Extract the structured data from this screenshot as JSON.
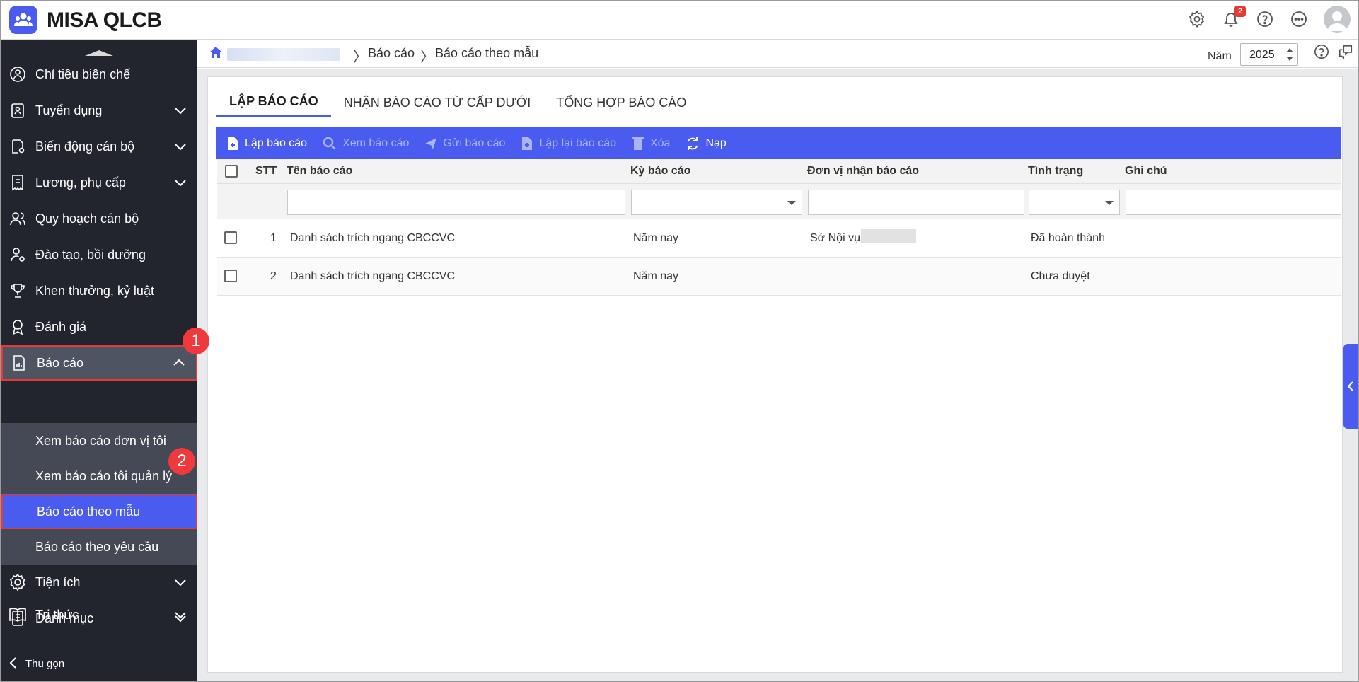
{
  "app": {
    "name": "MISA QLCB"
  },
  "topbar": {
    "notification_count": "2"
  },
  "sidebar": {
    "items": [
      {
        "label": "Chỉ tiêu biên chế"
      },
      {
        "label": "Tuyển dụng"
      },
      {
        "label": "Biến động cán bộ"
      },
      {
        "label": "Lương, phụ cấp"
      },
      {
        "label": "Quy hoạch cán bộ"
      },
      {
        "label": "Đào tạo, bồi dưỡng"
      },
      {
        "label": "Khen thưởng, kỷ luật"
      },
      {
        "label": "Đánh giá"
      },
      {
        "label": "Báo cáo"
      },
      {
        "label": "Tiện ích"
      },
      {
        "label": "Danh mục"
      },
      {
        "label": "Tri thức"
      }
    ],
    "sub_items": [
      {
        "label": "Xem báo cáo đơn vị tôi"
      },
      {
        "label": "Xem báo cáo tôi quản lý"
      },
      {
        "label": "Báo cáo theo mẫu"
      },
      {
        "label": "Báo cáo theo yêu cầu"
      }
    ],
    "step_markers": [
      "1",
      "2"
    ],
    "collapse_label": "Thu gọn"
  },
  "breadcrumb": {
    "items": [
      "Báo cáo",
      "Báo cáo theo mẫu"
    ],
    "year_label": "Năm",
    "year_value": "2025"
  },
  "tabs": [
    "LẬP BÁO CÁO",
    "NHẬN BÁO CÁO TỪ CẤP DƯỚI",
    "TỔNG HỢP BÁO CÁO"
  ],
  "toolbar": {
    "create": "Lập báo cáo",
    "view": "Xem báo cáo",
    "send": "Gửi báo cáo",
    "recreate": "Lập lại báo cáo",
    "delete": "Xóa",
    "reload": "Nạp"
  },
  "table": {
    "columns": [
      "STT",
      "Tên báo cáo",
      "Kỳ báo cáo",
      "Đơn vị nhận báo cáo",
      "Tình trạng",
      "Ghi chú"
    ],
    "rows": [
      {
        "stt": "1",
        "name": "Danh sách trích ngang CBCCVC",
        "period": "Năm nay",
        "receiver": "Sở Nội vụ",
        "status": "Đã hoàn thành",
        "note": ""
      },
      {
        "stt": "2",
        "name": "Danh sách trích ngang CBCCVC",
        "period": "Năm nay",
        "receiver": "",
        "status": "Chưa duyệt",
        "note": ""
      }
    ]
  },
  "colors": {
    "accent": "#4a5bf0",
    "sidebar_bg": "#22252d",
    "marker_red": "#f0393c"
  }
}
